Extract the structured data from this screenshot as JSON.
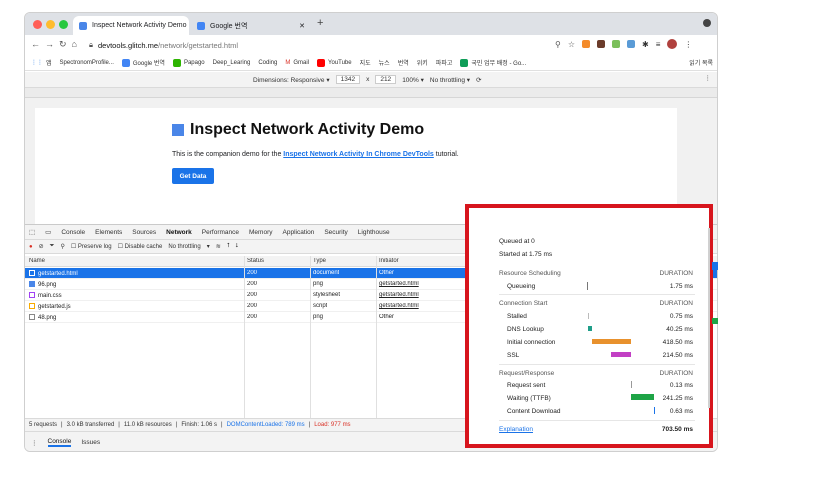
{
  "browser": {
    "tabs": [
      {
        "title": "Inspect Network Activity Demo",
        "active": true,
        "favicon_color": "#4a86e8"
      },
      {
        "title": "Google 번역",
        "active": false,
        "favicon_color": "#4285f4"
      }
    ],
    "url_host": "devtools.glitch.me",
    "url_path": "/network/getstarted.html",
    "bookmarks": [
      "앱",
      "SpectronomProfile...",
      "Google 번역",
      "Papago",
      "Deep_Learing",
      "Coding",
      "Gmail",
      "YouTube",
      "지도",
      "뉴스",
      "번역",
      "위키",
      "파파고",
      "국민 업무 배정 - Go...",
      "읽기 목록"
    ]
  },
  "device_toolbar": {
    "dimensions_label": "Dimensions: Responsive ▾",
    "width": "1342",
    "x": "x",
    "height": "212",
    "zoom": "100% ▾",
    "throttle": "No throttling ▾"
  },
  "page": {
    "title": "Inspect Network Activity Demo",
    "intro": "This is the companion demo for the ",
    "link": "Inspect Network Activity In Chrome DevTools",
    "outro": " tutorial.",
    "button": "Get Data"
  },
  "devtools": {
    "tabs": [
      "Console",
      "Elements",
      "Sources",
      "Network",
      "Performance",
      "Memory",
      "Application",
      "Security",
      "Lighthouse"
    ],
    "active_tab": "Network",
    "netbar": {
      "preserve_log": "Preserve log",
      "disable_cache": "Disable cache",
      "throttling": "No throttling"
    },
    "columns": [
      "Name",
      "Status",
      "Type",
      "Initiator"
    ],
    "rows": [
      {
        "name": "getstarted.html",
        "status": "200",
        "type": "document",
        "initiator": "Other",
        "link": false,
        "selected": true
      },
      {
        "name": "96.png",
        "status": "200",
        "type": "png",
        "initiator": "getstarted.html",
        "link": true,
        "selected": false
      },
      {
        "name": "main.css",
        "status": "200",
        "type": "stylesheet",
        "initiator": "getstarted.html",
        "link": true,
        "selected": false
      },
      {
        "name": "getstarted.js",
        "status": "200",
        "type": "script",
        "initiator": "getstarted.html",
        "link": true,
        "selected": false
      },
      {
        "name": "48.png",
        "status": "200",
        "type": "png",
        "initiator": "Other",
        "link": false,
        "selected": false
      }
    ],
    "status_bar": {
      "requests": "5 requests",
      "transferred": "3.0 kB transferred",
      "resources": "11.0 kB resources",
      "finish": "Finish: 1.06 s",
      "dcl": "DOMContentLoaded: 789 ms",
      "load": "Load: 977 ms"
    },
    "drawer_tabs": [
      "Console",
      "Issues"
    ]
  },
  "timing": {
    "queued": "Queued at 0",
    "started": "Started at 1.75 ms",
    "sections": [
      {
        "header": "Resource Scheduling",
        "duration_label": "DURATION",
        "items": [
          {
            "label": "Queueing",
            "value": "1.75 ms",
            "color": "#777777"
          }
        ]
      },
      {
        "header": "Connection Start",
        "duration_label": "DURATION",
        "items": [
          {
            "label": "Stalled",
            "value": "0.75 ms",
            "color": "#bbbbbb"
          },
          {
            "label": "DNS Lookup",
            "value": "40.25 ms",
            "color": "#1f9e89"
          },
          {
            "label": "Initial connection",
            "value": "418.50 ms",
            "color": "#e8912d"
          },
          {
            "label": "SSL",
            "value": "214.50 ms",
            "color": "#c23fc4"
          }
        ]
      },
      {
        "header": "Request/Response",
        "duration_label": "DURATION",
        "items": [
          {
            "label": "Request sent",
            "value": "0.13 ms",
            "color": "#999999"
          },
          {
            "label": "Waiting (TTFB)",
            "value": "241.25 ms",
            "color": "#1ea446"
          },
          {
            "label": "Content Download",
            "value": "0.63 ms",
            "color": "#1a73e8"
          }
        ]
      }
    ],
    "explanation": "Explanation",
    "total": "703.50 ms"
  }
}
